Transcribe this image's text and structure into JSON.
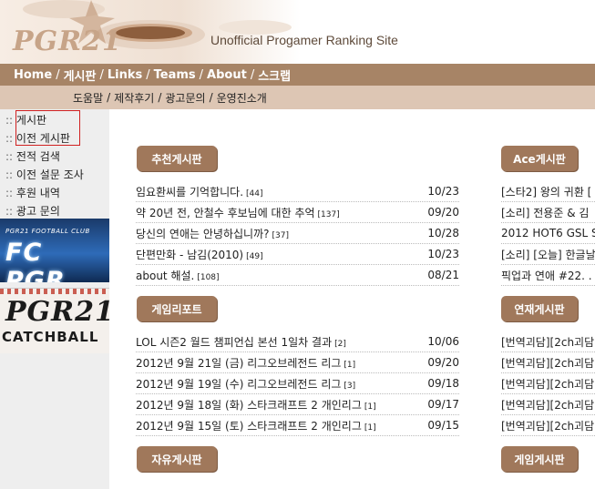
{
  "header": {
    "logo": "PGR21",
    "tagline": "Unofficial Progamer Ranking Site"
  },
  "nav": {
    "items": [
      "Home",
      "게시판",
      "Links",
      "Teams",
      "About",
      "스크랩"
    ],
    "sep": "/"
  },
  "subnav": {
    "items": [
      "도움말",
      "제작후기",
      "광고문의",
      "운영진소개"
    ],
    "sep": "/"
  },
  "sidebar": {
    "bullet": "::",
    "links": [
      "게시판",
      "이전 게시판",
      "전적 검색",
      "이전 설문 조사",
      "후원 내역",
      "광고 문의"
    ],
    "banner_fc": {
      "small": "PGR21 FOOTBALL CLUB",
      "big": "FC PGR"
    },
    "banner_catch": {
      "pgr": "PGR21",
      "catch": "CATCHBALL"
    }
  },
  "boards_left": [
    {
      "name": "추천게시판",
      "posts": [
        {
          "title": "임요환씨를 기억합니다.",
          "count": "[44]",
          "date": "10/23"
        },
        {
          "title": "약 20년 전, 안철수 후보님에 대한 추억",
          "count": "[137]",
          "date": "09/20"
        },
        {
          "title": "당신의 연애는 안녕하십니까?",
          "count": "[37]",
          "date": "10/28"
        },
        {
          "title": "단편만화 - 남김(2010)",
          "count": "[49]",
          "date": "10/23"
        },
        {
          "title": "about 해설.",
          "count": "[108]",
          "date": "08/21"
        }
      ]
    },
    {
      "name": "게임리포트",
      "posts": [
        {
          "title": "LOL 시즌2 월드 챔피언십 본선 1일차 결과",
          "count": "[2]",
          "date": "10/06"
        },
        {
          "title": "2012년 9월 21일 (금) 리그오브레전드 리그",
          "count": "[1]",
          "date": "09/20"
        },
        {
          "title": "2012년 9월 19일 (수) 리그오브레전드 리그",
          "count": "[3]",
          "date": "09/18"
        },
        {
          "title": "2012년 9월 18일 (화) 스타크래프트 2 개인리그",
          "count": "[1]",
          "date": "09/17"
        },
        {
          "title": "2012년 9월 15일 (토) 스타크래프트 2 개인리그",
          "count": "[1]",
          "date": "09/15"
        }
      ]
    },
    {
      "name": "자유게시판",
      "posts": []
    }
  ],
  "boards_right": [
    {
      "name": "Ace게시판",
      "posts": [
        {
          "title": "[스타2] 왕의 귀환 ["
        },
        {
          "title": "[소리] 전용준 & 김"
        },
        {
          "title": "2012 HOT6 GSL Se"
        },
        {
          "title": "[소리] [오늘] 한글날"
        },
        {
          "title": "픽업과 연애 #22. ."
        }
      ]
    },
    {
      "name": "연재게시판",
      "posts": [
        {
          "title": "[번역괴담][2ch괴담"
        },
        {
          "title": "[번역괴담][2ch괴담"
        },
        {
          "title": "[번역괴담][2ch괴담"
        },
        {
          "title": "[번역괴담][2ch괴담"
        },
        {
          "title": "[번역괴담][2ch괴담"
        }
      ]
    },
    {
      "name": "게임게시판",
      "posts": []
    }
  ],
  "colors": {
    "nav_bg": "#a78466",
    "subnav_bg": "#ddc6b4",
    "tab_bg": "#a0785b",
    "sidebar_bg": "#eeeeee",
    "highlight_border": "#d02020"
  }
}
